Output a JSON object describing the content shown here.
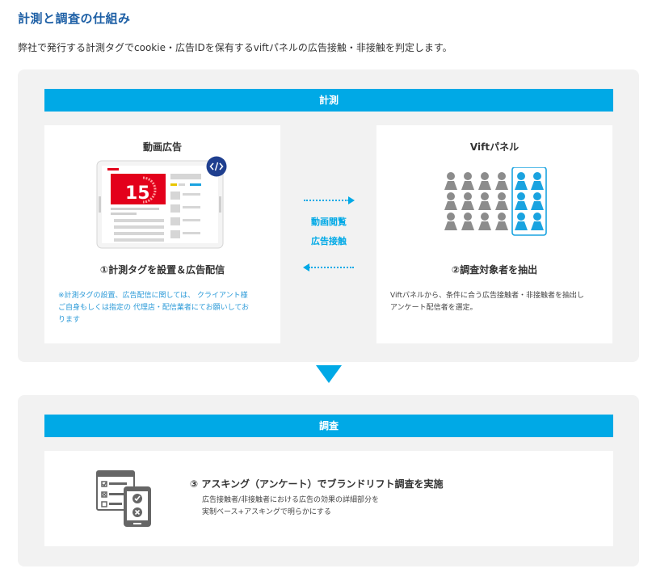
{
  "page": {
    "title": "計測と調査の仕組み",
    "lead": "弊社で発行する計測タグでcookie・広告IDを保有するviftパネルの広告接触・非接触を判定します。"
  },
  "measure": {
    "bar_label": "計測",
    "left_card": {
      "title": "動画広告",
      "countdown": "15",
      "step": "①計測タグを設置＆広告配信",
      "note_line1": "※計測タグの設置、広告配信に関しては、 クライアント様",
      "note_line2": "ご自身もしくは指定の 代理店・配信業者にてお願いしてお",
      "note_line3": "ります"
    },
    "middle": {
      "line1": "動画閲覧",
      "line2": "広告接触"
    },
    "right_card": {
      "title": "Viftパネル",
      "step": "②調査対象者を抽出",
      "desc_line1": "Viftパネルから、条件に合う広告接触者・非接触者を抽出し",
      "desc_line2": "アンケート配信者を選定。"
    }
  },
  "survey": {
    "bar_label": "調査",
    "step": "③ アスキング（アンケート）でブランドリフト調査を実施",
    "desc_line1": "広告接触者/非接触者における広告の効果の詳細部分を",
    "desc_line2": "実制ベース+アスキングで明らかにする"
  },
  "colors": {
    "accent": "#00a9e6",
    "title": "#1d5fa5",
    "panel": "#f2f2f2",
    "highlight_person": "#1aa3e0",
    "gray_person": "#8c8c8c",
    "ad_red": "#e3001b",
    "code_badge": "#1f3f8f"
  }
}
